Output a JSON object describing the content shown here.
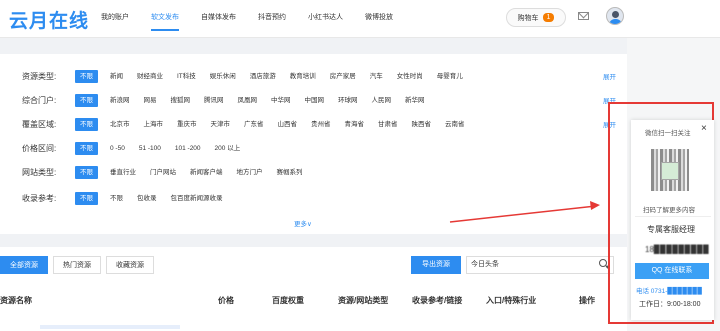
{
  "header": {
    "logo": "云月在线",
    "nav": [
      "我的账户",
      "软文发布",
      "自媒体发布",
      "抖音预约",
      "小红书达人",
      "微博投放"
    ],
    "cart_label": "购物车",
    "cart_count": "1"
  },
  "filters": {
    "rows": [
      {
        "label": "资源类型:",
        "options": [
          "不限",
          "新闻",
          "财经商业",
          "IT科技",
          "娱乐休闲",
          "酒店旅游",
          "教育培训",
          "房产家居",
          "汽车",
          "女性时尚",
          "母婴育儿"
        ],
        "expand": "展开"
      },
      {
        "label": "综合门户:",
        "options": [
          "不限",
          "新浪网",
          "网易",
          "搜狐网",
          "腾讯网",
          "凤凰网",
          "中华网",
          "中国网",
          "环球网",
          "人民网",
          "新华网"
        ],
        "expand": "展开"
      },
      {
        "label": "覆盖区域:",
        "options": [
          "不限",
          "北京市",
          "上海市",
          "重庆市",
          "天津市",
          "广东省",
          "山西省",
          "贵州省",
          "青海省",
          "甘肃省",
          "陕西省",
          "云南省"
        ],
        "expand": "展开"
      },
      {
        "label": "价格区间:",
        "options": [
          "不限",
          "0 -50",
          "51 -100",
          "101 -200",
          "200 以上"
        ]
      },
      {
        "label": "网站类型:",
        "options": [
          "不限",
          "垂直行业",
          "门户网站",
          "新闻客户端",
          "地方门户",
          "赛帼系列"
        ]
      },
      {
        "label": "收录参考:",
        "options": [
          "不限",
          "不限",
          "包收录",
          "包百度新闻源收录"
        ]
      }
    ],
    "more": "更多∨"
  },
  "lower": {
    "tabs": [
      "全部资源",
      "热门资源",
      "收藏资源"
    ],
    "export": "导出资源",
    "search_value": "今日头条",
    "columns": [
      "资源名称",
      "价格",
      "百度权重",
      "资源/网站类型",
      "收录参考/链接",
      "入口/特殊行业",
      "操作"
    ]
  },
  "popup": {
    "title": "微信扫一扫关注",
    "close": "×",
    "scan_text": "扫码了解更多内容",
    "manager": "专属客服经理",
    "phone": "18▉▉▉▉▉▉▉▉▉",
    "qq_button": "QQ 在线联系",
    "tel": "电话 0731-▉▉▉▉▉▉▉",
    "hours": "工作日：9:00-18:00"
  }
}
